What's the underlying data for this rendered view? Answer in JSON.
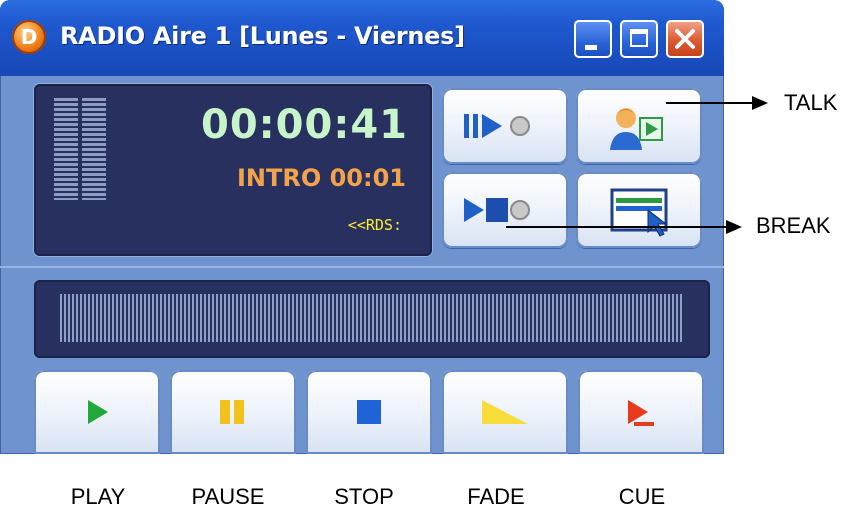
{
  "window": {
    "title": "RADIO Aire 1 [Lunes - Viernes]",
    "app_icon_letter": "D",
    "controls": [
      "minimize",
      "maximize",
      "close"
    ]
  },
  "display": {
    "time": "00:00:41",
    "intro": "INTRO 00:01",
    "rds": "<<RDS:"
  },
  "control_buttons": [
    {
      "icon": "play-next-icon",
      "indicator": "off"
    },
    {
      "icon": "talk-icon"
    },
    {
      "icon": "stop-next-icon",
      "indicator": "off"
    },
    {
      "icon": "break-icon"
    }
  ],
  "transport": {
    "buttons": [
      {
        "icon": "play-icon",
        "color": "#22a83a"
      },
      {
        "icon": "pause-icon",
        "color": "#f1c21b"
      },
      {
        "icon": "stop-icon",
        "color": "#1f63d6"
      },
      {
        "icon": "fade-icon",
        "color": "#f7dc3a"
      },
      {
        "icon": "cue-icon",
        "color": "#e83a1c"
      }
    ]
  },
  "annotations": {
    "talk": "TALK",
    "break": "BREAK",
    "play": "PLAY",
    "pause": "PAUSE",
    "stop": "STOP",
    "fade": "FADE",
    "cue": "CUE"
  }
}
